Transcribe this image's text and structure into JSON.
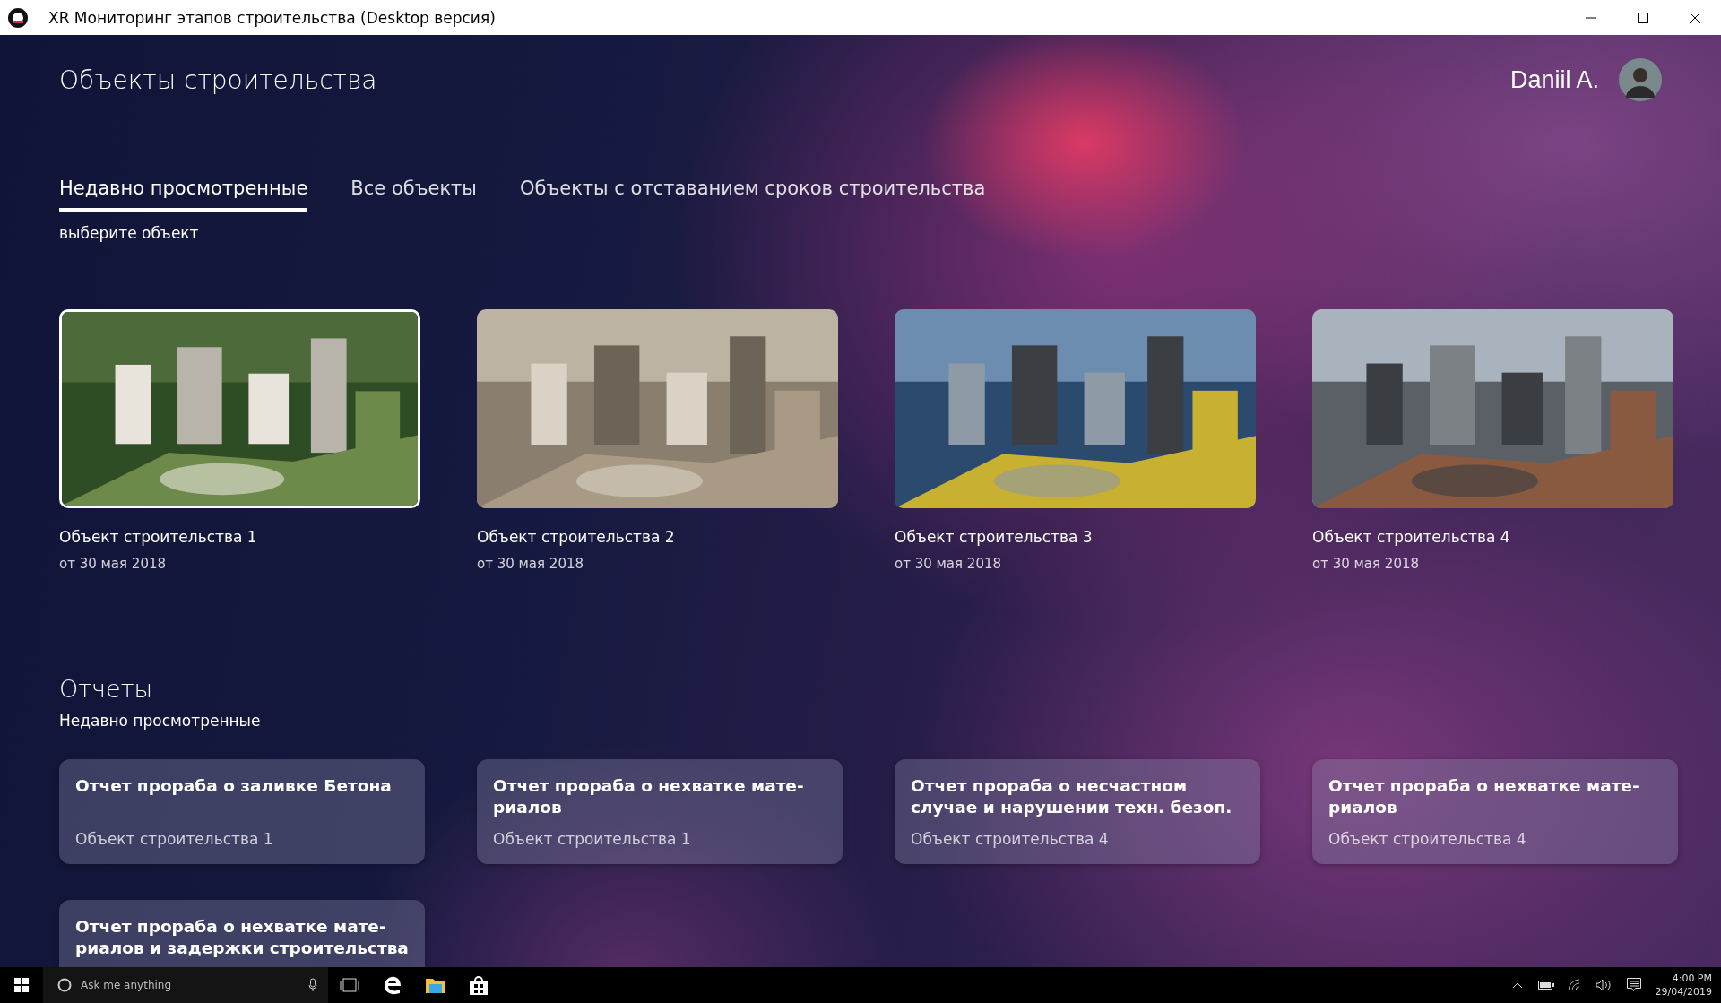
{
  "window": {
    "title": "XR Мониторинг этапов строительства (Desktop версия)"
  },
  "header": {
    "title": "Объекты строительства",
    "user": "Daniil A."
  },
  "tabs": [
    {
      "label": "Недавно просмотренные",
      "selected": true
    },
    {
      "label": "Все объекты",
      "selected": false
    },
    {
      "label": "Объекты с отставанием сроков строительства",
      "selected": false
    }
  ],
  "hint": "выберите объект",
  "objects": [
    {
      "name": "Объект строительства 1",
      "date": "от 30 мая 2018",
      "selected": true
    },
    {
      "name": "Объект строительства 2",
      "date": "от 30 мая 2018",
      "selected": false
    },
    {
      "name": "Объект строительства 3",
      "date": "от 30 мая 2018",
      "selected": false
    },
    {
      "name": "Объект строительства 4",
      "date": "от 30 мая 2018",
      "selected": false
    }
  ],
  "reports": {
    "title": "Отчеты",
    "subtitle": "Недавно просмотренные",
    "items": [
      {
        "title_lines": [
          "Отчет прораба о заливке Бетона"
        ],
        "object": "Объект строительства 1"
      },
      {
        "title_lines": [
          "Отчет прораба о нехватке мате-",
          "риалов"
        ],
        "object": "Объект строительства 1"
      },
      {
        "title_lines": [
          "Отчет прораба о несчастном",
          "случае и нарушении техн. безоп."
        ],
        "object": "Объект строительства 4"
      },
      {
        "title_lines": [
          "Отчет прораба о нехватке мате-",
          "риалов"
        ],
        "object": "Объект строительства 4"
      },
      {
        "title_lines": [
          "Отчет прораба о нехватке мате-",
          "риалов и задержки строительства"
        ]
      }
    ]
  },
  "taskbar": {
    "search_placeholder": "Ask me anything",
    "time": "4:00 PM",
    "date": "29/04/2019"
  }
}
